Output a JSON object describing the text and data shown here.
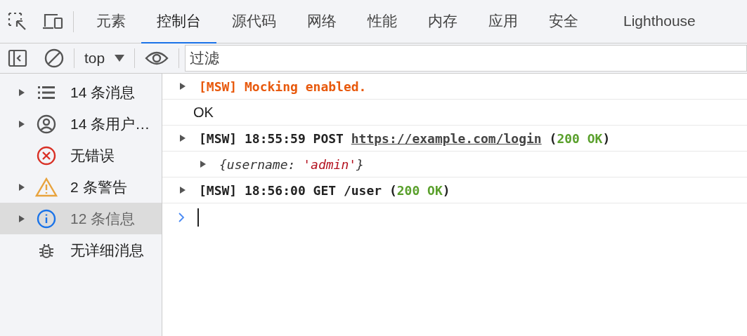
{
  "tabs": [
    {
      "label": "元素",
      "selected": false
    },
    {
      "label": "控制台",
      "selected": true
    },
    {
      "label": "源代码",
      "selected": false
    },
    {
      "label": "网络",
      "selected": false
    },
    {
      "label": "性能",
      "selected": false
    },
    {
      "label": "内存",
      "selected": false
    },
    {
      "label": "应用",
      "selected": false
    },
    {
      "label": "安全",
      "selected": false
    },
    {
      "label": "Lighthouse",
      "selected": false
    }
  ],
  "toolbar": {
    "context": "top",
    "filter": {
      "placeholder": "过滤"
    }
  },
  "sidebar": {
    "items": [
      {
        "kind": "list",
        "label": "14 条消息",
        "expandable": true,
        "selected": false
      },
      {
        "kind": "user",
        "label": "14 条用户…",
        "expandable": true,
        "selected": false
      },
      {
        "kind": "error",
        "label": "无错误",
        "expandable": false,
        "selected": false
      },
      {
        "kind": "warning",
        "label": "2 条警告",
        "expandable": true,
        "selected": false
      },
      {
        "kind": "info",
        "label": "12 条信息",
        "expandable": true,
        "selected": true
      },
      {
        "kind": "verbose",
        "label": "无详细消息",
        "expandable": false,
        "selected": false
      }
    ]
  },
  "console": {
    "lines": [
      {
        "kind": "log",
        "expandable": true,
        "segments": [
          {
            "kind": "styled",
            "text": "[MSW] Mocking enabled."
          }
        ]
      },
      {
        "kind": "plain",
        "expandable": false,
        "segments": [
          {
            "kind": "plain",
            "text": "OK"
          }
        ]
      },
      {
        "kind": "log",
        "expandable": true,
        "segments": [
          {
            "kind": "text",
            "text": "[MSW] 18:55:59 POST "
          },
          {
            "kind": "link",
            "text": "https://example.com/login"
          },
          {
            "kind": "text",
            "text": " ("
          },
          {
            "kind": "status",
            "text": "200 OK"
          },
          {
            "kind": "text",
            "text": ")"
          }
        ]
      },
      {
        "kind": "object",
        "expandable": true,
        "segments": [
          {
            "kind": "key",
            "text": "{username: "
          },
          {
            "kind": "string",
            "text": "'admin'"
          },
          {
            "kind": "key",
            "text": "}"
          }
        ]
      },
      {
        "kind": "log",
        "expandable": true,
        "segments": [
          {
            "kind": "text",
            "text": "[MSW] 18:56:00 GET /user ("
          },
          {
            "kind": "status",
            "text": "200 OK"
          },
          {
            "kind": "text",
            "text": ")"
          }
        ]
      }
    ]
  }
}
